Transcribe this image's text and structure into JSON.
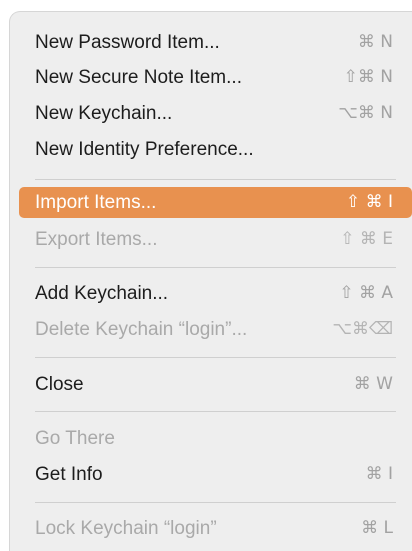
{
  "menu": {
    "items": [
      {
        "label": "New Password Item...",
        "shortcut": "⌘ N",
        "enabled": true
      },
      {
        "label": "New Secure Note Item...",
        "shortcut": "⇧⌘ N",
        "enabled": true
      },
      {
        "label": "New Keychain...",
        "shortcut": "⌥⌘ N",
        "enabled": true
      },
      {
        "label": "New Identity Preference...",
        "shortcut": "",
        "enabled": true
      },
      {
        "label": "Import Items...",
        "shortcut": "⇧ ⌘  I",
        "enabled": true,
        "highlighted": true
      },
      {
        "label": "Export Items...",
        "shortcut": "⇧ ⌘ E",
        "enabled": false
      },
      {
        "label": "Add Keychain...",
        "shortcut": "⇧ ⌘ A",
        "enabled": true
      },
      {
        "label": "Delete Keychain “login”...",
        "shortcut": "⌥⌘⌫",
        "enabled": false
      },
      {
        "label": "Close",
        "shortcut": "⌘ W",
        "enabled": true
      },
      {
        "label": "Go There",
        "shortcut": "",
        "enabled": false
      },
      {
        "label": "Get Info",
        "shortcut": "⌘  I",
        "enabled": true
      },
      {
        "label": "Lock Keychain “login”",
        "shortcut": "⌘ L",
        "enabled": true
      }
    ]
  },
  "colors": {
    "highlight": "#e8914f",
    "menu_background": "#eeeeee",
    "text": "#1d1d1d",
    "disabled_text": "#a9a9a9"
  }
}
